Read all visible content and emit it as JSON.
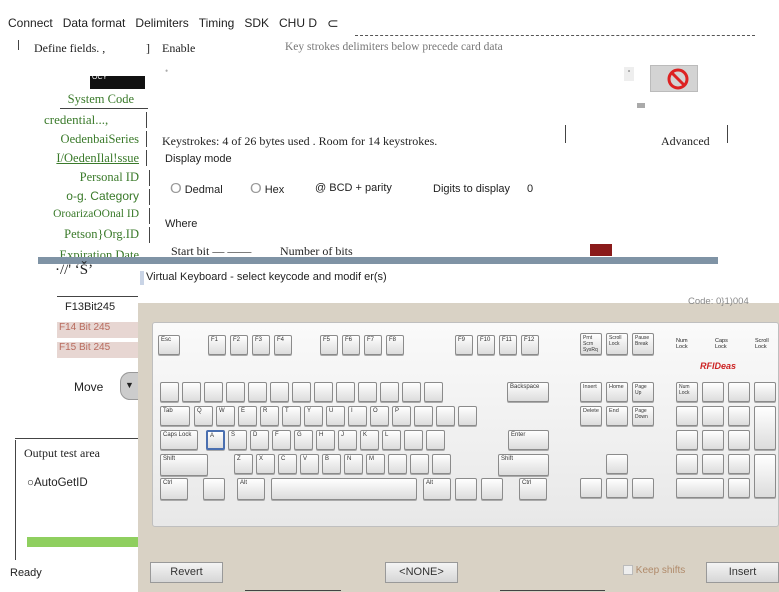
{
  "menu": {
    "items": [
      "Connect",
      "Data format",
      "Delimiters",
      "Timing",
      "SDK",
      "CHU D"
    ]
  },
  "fields": {
    "define_label": "Define fields. ,",
    "bracket": "]",
    "enable_label": "Enable",
    "keystroke_note": "Key strokes delimiters below precede card data",
    "selected_item": "OCY"
  },
  "left_list": {
    "items": [
      "System Code",
      "credential..., ",
      "OedenbaiSeries",
      "I/OedenIlal!ssue",
      "Personal ID",
      "o-g. Category",
      "OroarizaOOnal ID",
      "Petson}Org.ID",
      "Expiration Date"
    ]
  },
  "glyph_text": "·//'  ‘Š’",
  "bit_rows": [
    "F13Bit245",
    "F14 Bit 245",
    "F15 Bit 245"
  ],
  "move_label": "Move",
  "output": {
    "title": "Output test area",
    "autoget_label": "AutoGetID"
  },
  "status": {
    "text": "Ready"
  },
  "keystrokes": {
    "info": "Keystrokes: 4 of 26 bytes used . Room for 14 keystrokes.",
    "advanced_label": "Advanced"
  },
  "display_mode": {
    "label": "Display mode",
    "options": [
      "Dedmal",
      "Hex",
      "BCD + parity"
    ],
    "digits_label": "Digits to display",
    "digits_value": "0"
  },
  "where_label": "Where",
  "start_bit_label": "Start bit — ——",
  "number_bits_label": "Number of bits",
  "virtual_keyboard": {
    "title": "Virtual Keyboard -  select keycode and modif er(s)",
    "code": "Code: 0}1)004",
    "brand": "RFIDeas",
    "revert_label": "Revert",
    "none_label": "<NONE>",
    "keep_shifts_label": "Keep shifts",
    "insert_label": "Insert"
  },
  "keys": {
    "esc": "Esc",
    "f1": "F1",
    "f2": "F2",
    "f3": "F3",
    "f4": "F4",
    "f5": "F5",
    "f6": "F6",
    "f7": "F7",
    "f8": "F8",
    "f9": "F9",
    "f10": "F10",
    "f11": "F11",
    "f12": "F12",
    "prt": "Prnt Scrn SysRq",
    "scroll": "Scroll Lock",
    "pause": "Pause Break",
    "num_lbl": "Num Lock",
    "caps_lbl": "Caps Lock",
    "scroll_lbl": "Scroll Lock",
    "backspace": "Backspace",
    "insert": "Insert",
    "home": "Home",
    "pgup": "Page Up",
    "delete": "Delete",
    "end": "End",
    "pgdn": "Page Down",
    "tab": "Tab",
    "caps": "Caps Lock",
    "enter": "Enter",
    "shift": "Shift",
    "ctrl": "Ctrl",
    "alt": "Alt",
    "num": "Num Lock",
    "q": "Q",
    "w": "W",
    "e": "E",
    "r": "R",
    "t": "T",
    "y": "Y",
    "u": "U",
    "i": "I",
    "o": "O",
    "p": "P",
    "a": "A",
    "s": "S",
    "d": "D",
    "f": "F",
    "g": "G",
    "h": "H",
    "j": "J",
    "k": "K",
    "l": "L",
    "z": "Z",
    "x": "X",
    "c": "C",
    "v": "V",
    "b": "B",
    "n": "N",
    "m": "M"
  },
  "colors": {
    "accent_green": "#3a7a2a",
    "banner": "#7f93a5",
    "kbd_bg": "#d9d2c5",
    "brand_red": "#cc2222"
  }
}
